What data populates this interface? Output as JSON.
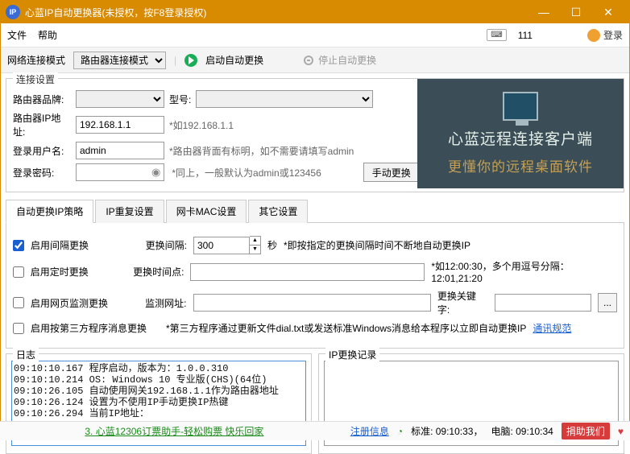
{
  "window": {
    "title": "心蓝IP自动更换器(未授权，按F8登录授权)"
  },
  "menu": {
    "file": "文件",
    "help": "帮助",
    "kbnum": "111",
    "login": "登录"
  },
  "toolbar": {
    "mode_label": "网络连接模式",
    "mode_value": "路由器连接模式",
    "start": "启动自动更换",
    "stop": "停止自动更换"
  },
  "conn": {
    "legend": "连接设置",
    "brand_label": "路由器品牌:",
    "model_label": "型号:",
    "ip_label": "路由器IP地址:",
    "ip_value": "192.168.1.1",
    "ip_hint": "*如192.168.1.1",
    "user_label": "登录用户名:",
    "user_value": "admin",
    "user_hint": "*路由器背面有标明，如不需要请填写admin",
    "pwd_label": "登录密码:",
    "pwd_hint": "*同上，一般默认为admin或123456",
    "manual": "手动更换"
  },
  "banner": {
    "line1": "心蓝远程连接客户端",
    "line2": "更懂你的远程桌面软件"
  },
  "tabs": {
    "t1": "自动更换IP策略",
    "t2": "IP重复设置",
    "t3": "网卡MAC设置",
    "t4": "其它设置"
  },
  "opts": {
    "interval_chk": "启用间隔更换",
    "interval_lbl": "更换间隔:",
    "interval_val": "300",
    "interval_unit": "秒",
    "interval_hint": "*即按指定的更换间隔时间不断地自动更换IP",
    "timed_chk": "启用定时更换",
    "timed_lbl": "更换时间点:",
    "timed_hint": "*如12:00:30，多个用逗号分隔：12:01,21:20",
    "web_chk": "启用网页监测更换",
    "web_lbl": "监测网址:",
    "web_kw": "更换关键字:",
    "web_btn": "...",
    "third_chk": "启用按第三方程序消息更换",
    "third_hint": "*第三方程序通过更新文件dial.txt或发送标准Windows消息给本程序以立即自动更换IP",
    "third_link": "通讯规范"
  },
  "log": {
    "legend": "日志",
    "text": "09:10:10.167 程序启动，版本为：1.0.0.310\n09:10:10.214 OS: Windows 10 专业版(CHS)(64位)\n09:10:26.105 自动使用网关192.168.1.1作为路由器地址\n09:10:26.124 设置为不使用IP手动更换IP热键\n09:10:26.294 当前IP地址：\n"
  },
  "iphist": {
    "legend": "IP更换记录"
  },
  "status": {
    "promo": "3. 心蓝12306订票助手-轻松购票 快乐回家",
    "reg": "注册信息",
    "std": "标准: 09:10:33，",
    "pc": "电脑: 09:10:34",
    "donate": "捐助我们"
  }
}
